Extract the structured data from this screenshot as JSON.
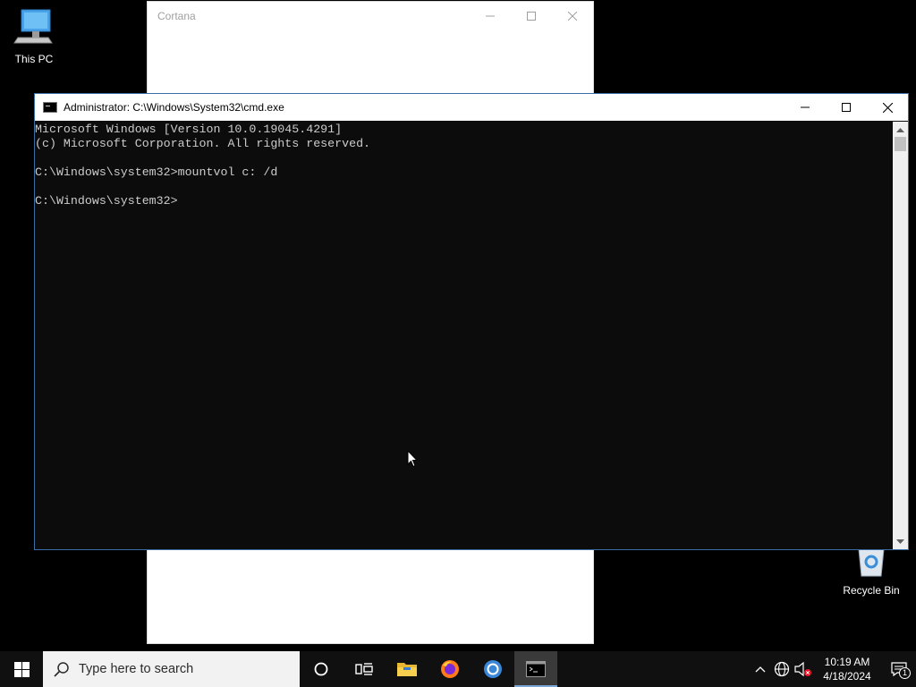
{
  "desktop": {
    "icons": [
      {
        "label": "This PC"
      },
      {
        "label": "Recycle Bin"
      }
    ]
  },
  "cortana_window": {
    "title": "Cortana"
  },
  "cmd_window": {
    "title": "Administrator: C:\\Windows\\System32\\cmd.exe",
    "lines": [
      "Microsoft Windows [Version 10.0.19045.4291]",
      "(c) Microsoft Corporation. All rights reserved.",
      "",
      "C:\\Windows\\system32>mountvol c: /d",
      "",
      "C:\\Windows\\system32>"
    ]
  },
  "taskbar": {
    "search_placeholder": "Type here to search",
    "apps": [
      "cortana-icon",
      "task-view-icon",
      "file-explorer-icon",
      "firefox-icon",
      "chrome-icon",
      "cmd-icon"
    ],
    "active_app": "cmd-icon",
    "clock_time": "10:19 AM",
    "clock_date": "4/18/2024",
    "notification_count": "1"
  }
}
